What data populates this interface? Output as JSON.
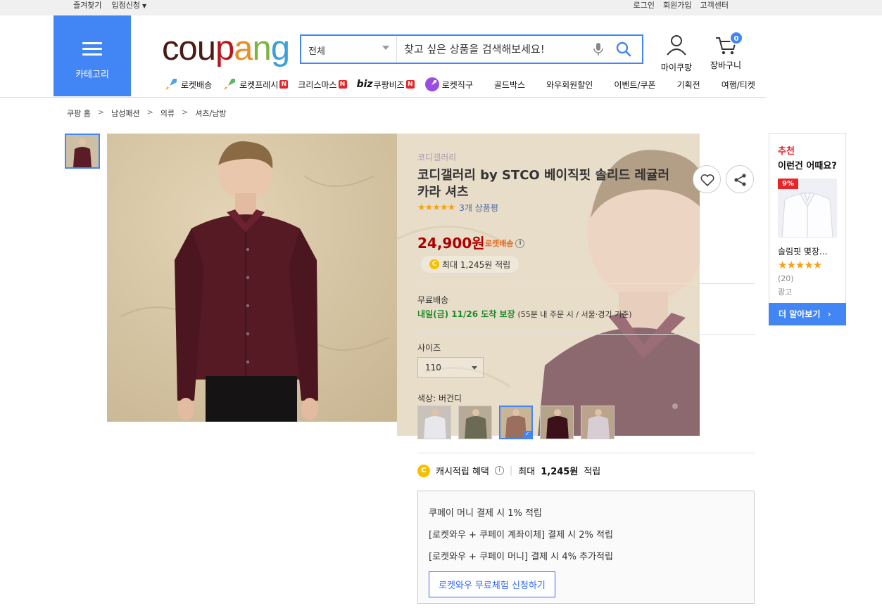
{
  "topbar": {
    "bookmark": "즐겨찾기",
    "seller": "입점신청",
    "login": "로그인",
    "signup": "회원가입",
    "support": "고객센터"
  },
  "category_button": {
    "label": "카테고리"
  },
  "logo": {
    "p1": "cou",
    "p2": "p",
    "p3": "a",
    "p4": "n",
    "p5": "g"
  },
  "search": {
    "category": "전체",
    "placeholder": "찾고 싶은 상품을 검색해보세요!"
  },
  "header_icons": {
    "mycoupang": "마이쿠팡",
    "cart": "장바구니",
    "cart_count": "0"
  },
  "nav": {
    "items": [
      "로켓배송",
      "로켓프레시",
      "크리스마스",
      "쿠팡비즈",
      "로켓직구",
      "골드박스",
      "와우회원할인",
      "이벤트/쿠폰",
      "기획전",
      "여행/티켓"
    ],
    "biz_prefix": "biz",
    "new_badge": "N"
  },
  "breadcrumb": [
    "쿠팡 홈",
    "남성패션",
    "의류",
    "셔츠/남방"
  ],
  "breadcrumb_sep": ">",
  "product": {
    "brand": "코디갤러리",
    "name": "코디갤러리 by STCO 베이직핏 솔리드 레귤러 카라 셔츠",
    "stars": "★★★★★",
    "reviews": "3개 상품평",
    "price": "24,900원",
    "rocket_tag": "로켓배송",
    "reward": "최대 1,245원 적립",
    "shipping_title": "무료배송",
    "shipping_date": "내일(금) 11/26 도착 보장",
    "shipping_note": "(55분 내 주문 시 / 서울⋅경기 기준)",
    "size_label": "사이즈",
    "size_value": "110",
    "color_label": "색상: 버건디"
  },
  "cash": {
    "label": "캐시적립 혜택",
    "max": "최대",
    "amount": "1,245원",
    "suffix": "적립"
  },
  "benefit": {
    "line1": "쿠페이 머니 결제 시 1% 적립",
    "line2": "[로켓와우 + 쿠페이 계좌이체] 결제 시 2% 적립",
    "line3": "[로켓와우 + 쿠페이 머니] 결제 시 4% 추가적립",
    "button": "로켓와우 무료체험 신청하기"
  },
  "recommend": {
    "title1": "추천",
    "title2": "이런건 어때요?",
    "discount": "9%",
    "product": "슬림핏 몇장...",
    "stars": "★★★★★",
    "count": "(20)",
    "ad": "광고",
    "more": "더 알아보기"
  },
  "colors": {
    "accent": "#4285f4",
    "price": "#ae0000",
    "shirt": "#5a1c27"
  }
}
